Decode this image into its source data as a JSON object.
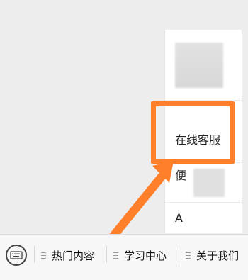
{
  "popup_menu": {
    "items": [
      {
        "label": ""
      },
      {
        "label": "在线客服"
      },
      {
        "label": "便"
      },
      {
        "label": "A"
      }
    ]
  },
  "bottom_menu": {
    "items": [
      {
        "label": "热门内容"
      },
      {
        "label": "学习中心"
      },
      {
        "label": "关于我们"
      }
    ]
  },
  "annotation": {
    "highlight_color": "#ff7f2a"
  },
  "icons": {
    "keyboard": "keyboard-icon",
    "menu_lines": "menu-lines-icon",
    "arrow": "annotation-arrow-icon"
  }
}
